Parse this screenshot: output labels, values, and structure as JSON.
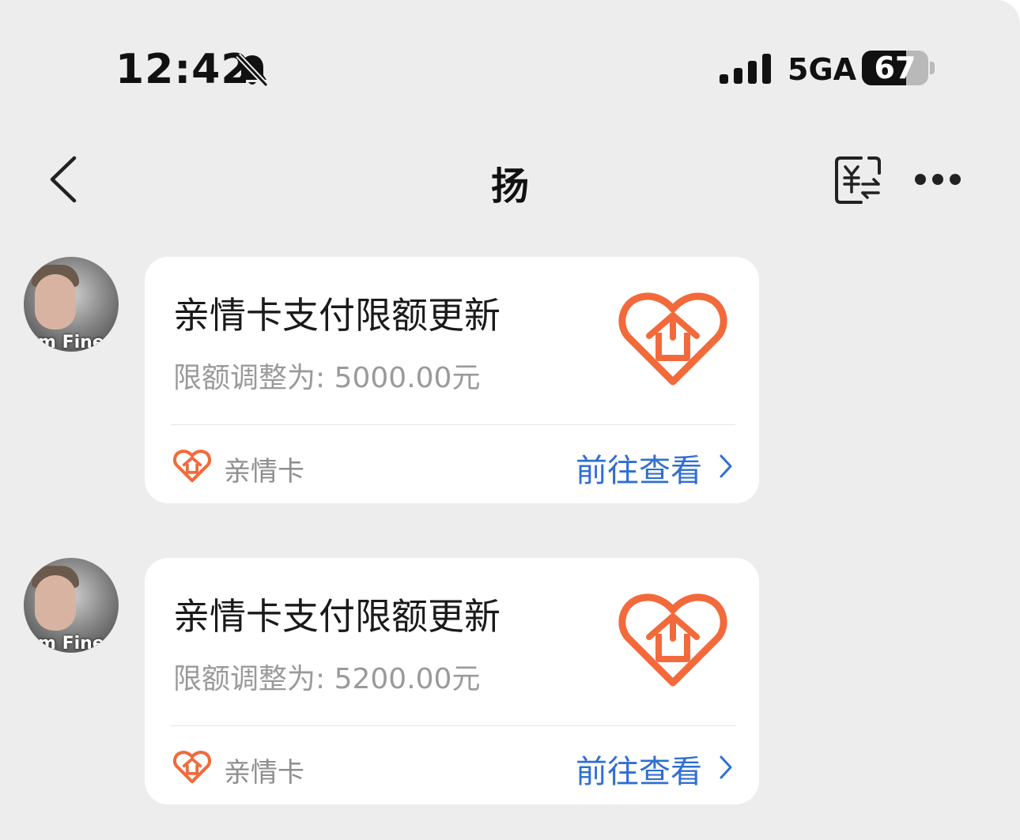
{
  "status_bar": {
    "time": "12:42",
    "network": "5GA",
    "battery": "67",
    "battery_level_percent": 67,
    "icons": [
      "bell-muted-icon",
      "signal-icon",
      "battery-icon"
    ]
  },
  "nav": {
    "title": "扬",
    "icons": [
      "back-icon",
      "yuan-transfer-icon",
      "more-icon"
    ]
  },
  "messages": [
    {
      "avatar_caption": "m Fine",
      "card_title": "亲情卡支付限额更新",
      "card_desc": "限额调整为: 5000.00元",
      "footer_label": "亲情卡",
      "footer_link": "前往查看"
    },
    {
      "avatar_caption": "m Fine",
      "card_title": "亲情卡支付限额更新",
      "card_desc": "限额调整为: 5200.00元",
      "footer_label": "亲情卡",
      "footer_link": "前往查看"
    }
  ],
  "colors": {
    "background": "#ededed",
    "card": "#ffffff",
    "accent_orange": "#f26a3b",
    "link_blue": "#2f6fd1"
  }
}
